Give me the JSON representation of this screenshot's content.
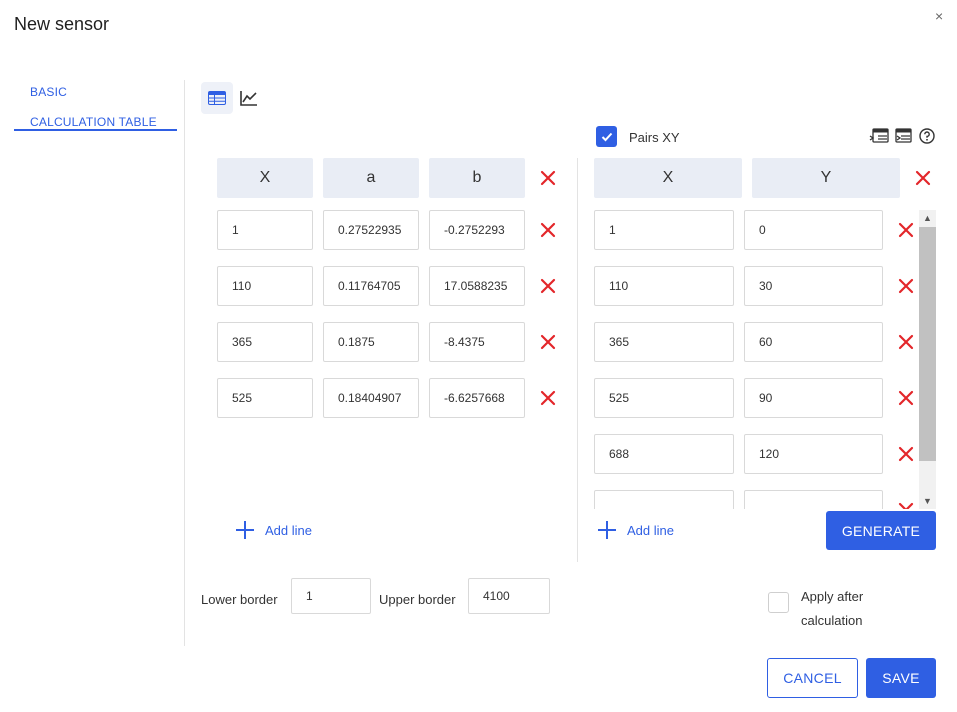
{
  "dialog": {
    "title": "New sensor",
    "close_glyph": "×"
  },
  "sidebar": {
    "items": [
      {
        "label": "BASIC"
      },
      {
        "label": "CALCULATION TABLE"
      }
    ]
  },
  "pairs": {
    "label": "Pairs XY",
    "checked": true
  },
  "left_table": {
    "headers": [
      "X",
      "a",
      "b"
    ],
    "rows": [
      [
        "1",
        "0.27522935",
        "-0.2752293"
      ],
      [
        "110",
        "0.11764705",
        "17.0588235"
      ],
      [
        "365",
        "0.1875",
        "-8.4375"
      ],
      [
        "525",
        "0.18404907",
        "-6.6257668"
      ]
    ],
    "add_label": "Add line"
  },
  "right_table": {
    "headers": [
      "X",
      "Y"
    ],
    "rows": [
      [
        "1",
        "0"
      ],
      [
        "110",
        "30"
      ],
      [
        "365",
        "60"
      ],
      [
        "525",
        "90"
      ],
      [
        "688",
        "120"
      ],
      [
        "",
        ""
      ]
    ],
    "add_label": "Add line"
  },
  "borders": {
    "lower_label": "Lower border",
    "lower_value": "1",
    "upper_label": "Upper border",
    "upper_value": "4100"
  },
  "apply": {
    "label_line1": "Apply after",
    "label_line2": "calculation",
    "checked": false
  },
  "buttons": {
    "generate": "GENERATE",
    "cancel": "CANCEL",
    "save": "SAVE"
  },
  "colors": {
    "accent": "#2f5fe3",
    "delete": "#e3262a",
    "header_bg": "#e9edf5"
  }
}
